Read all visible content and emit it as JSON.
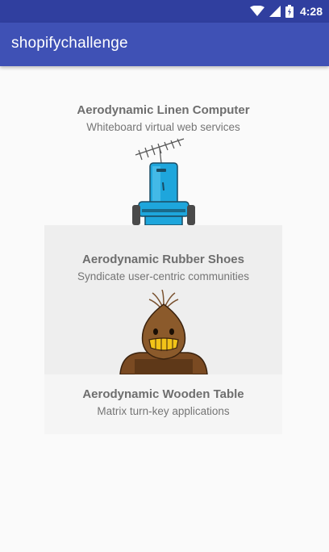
{
  "status_bar": {
    "time": "4:28",
    "icons": [
      "wifi-icon",
      "cellular-signal-icon",
      "battery-icon"
    ]
  },
  "app_bar": {
    "title": "shopifychallenge"
  },
  "products": [
    {
      "title": "Aerodynamic Linen Computer",
      "subtitle": "Whiteboard virtual web services",
      "image_icon": "robot-with-antenna-illustration"
    },
    {
      "title": "Aerodynamic Rubber Shoes",
      "subtitle": "Syndicate user-centric communities",
      "image_icon": "onion-head-character-illustration"
    },
    {
      "title": "Aerodynamic Wooden Table",
      "subtitle": "Matrix turn-key applications"
    }
  ],
  "colors": {
    "status_bar": "#303f9f",
    "app_bar": "#3f51b5",
    "background": "#fafafa",
    "selected_card": "#eeeeee"
  }
}
